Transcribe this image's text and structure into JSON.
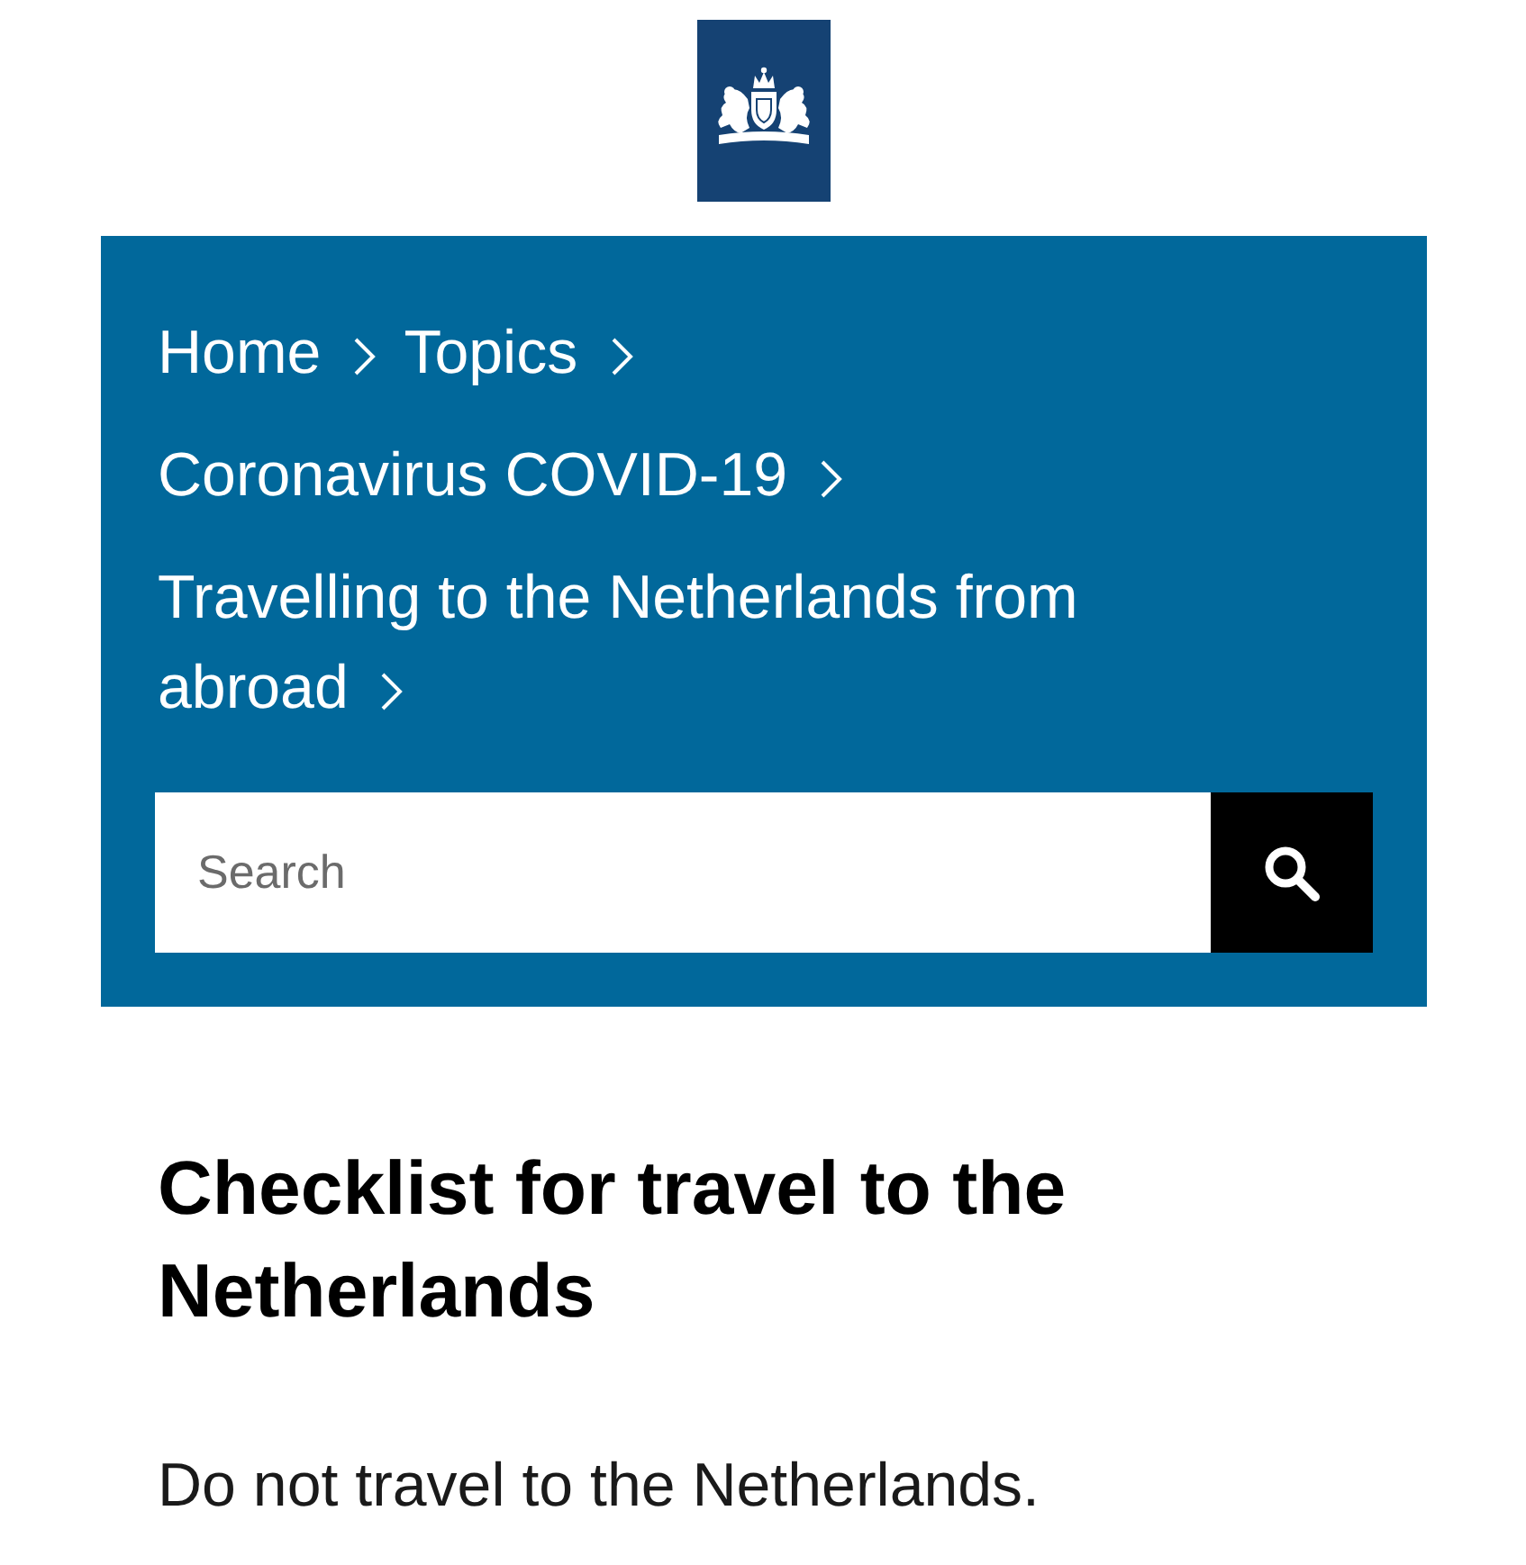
{
  "breadcrumbs": [
    "Home",
    "Topics",
    "Coronavirus COVID-19",
    "Travelling to the Netherlands from abroad"
  ],
  "search": {
    "placeholder": "Search"
  },
  "heading": "Checklist for travel to the Netherlands",
  "paragraph": "Do not travel to the Netherlands."
}
